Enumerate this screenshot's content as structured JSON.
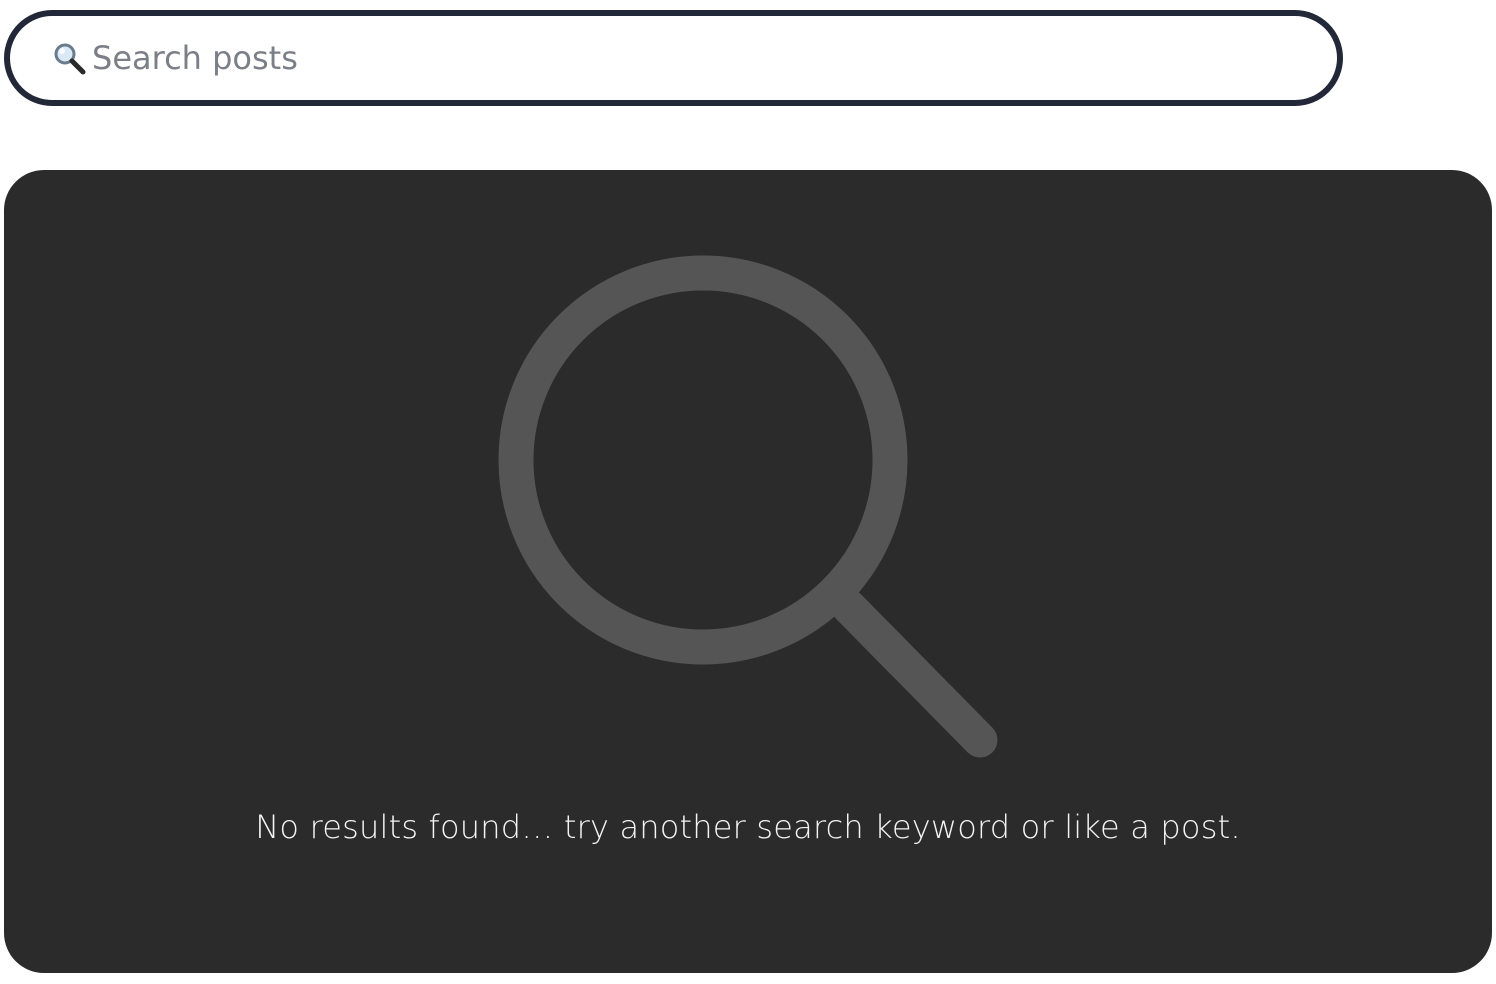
{
  "search": {
    "placeholder": "Search posts",
    "value": "",
    "icon": "magnifier-emoji-icon"
  },
  "empty_state": {
    "icon": "search-icon",
    "message": "No results found… try another search keyword or like a post."
  },
  "colors": {
    "search_border": "#232838",
    "card_background": "#2b2b2b",
    "icon_stroke": "#555555",
    "message_text": "#f4f4f4",
    "placeholder_text": "#7b7f88"
  }
}
